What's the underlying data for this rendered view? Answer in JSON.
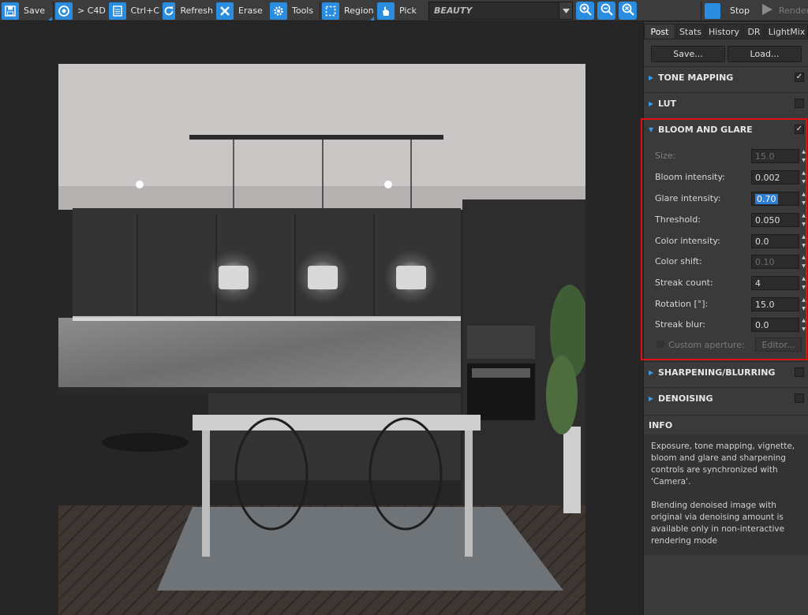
{
  "toolbar": {
    "save": "Save",
    "to_c4d": "> C4D",
    "copy": "Ctrl+C",
    "refresh": "Refresh",
    "erase": "Erase",
    "tools": "Tools",
    "region": "Region",
    "pick": "Pick",
    "render_pass": "BEAUTY",
    "stop": "Stop",
    "render": "Render"
  },
  "icons": {
    "save": "floppy-disk-icon",
    "to_c4d": "c4d-logo-icon",
    "copy": "clipboard-icon",
    "refresh": "refresh-icon",
    "erase": "erase-x-icon",
    "tools": "gear-icon",
    "region": "region-select-icon",
    "pick": "hand-pick-icon",
    "zoom_in": "zoom-in-icon",
    "zoom_out": "zoom-out-icon",
    "zoom_fit": "zoom-fit-icon",
    "stop": "stop-square-icon",
    "render": "play-icon"
  },
  "colors": {
    "accent": "#2a8de0",
    "highlight_border": "#e01010",
    "panel_bg": "#3a3a3a",
    "viewport_bg": "#262626"
  },
  "panel": {
    "tabs": [
      "Post",
      "Stats",
      "History",
      "DR",
      "LightMix"
    ],
    "active_tab": "Post",
    "save_button": "Save...",
    "load_button": "Load...",
    "sections": {
      "tone_mapping": {
        "label": "TONE MAPPING",
        "enabled": true,
        "expanded": false
      },
      "lut": {
        "label": "LUT",
        "enabled": false,
        "expanded": false
      },
      "bloom": {
        "label": "BLOOM AND GLARE",
        "enabled": true,
        "expanded": true
      },
      "sharpening": {
        "label": "SHARPENING/BLURRING",
        "enabled": false,
        "expanded": false
      },
      "denoising": {
        "label": "DENOISING",
        "enabled": false,
        "expanded": false
      }
    },
    "bloom_params": [
      {
        "label": "Size:",
        "value": "15.0",
        "disabled": true
      },
      {
        "label": "Bloom intensity:",
        "value": "0.002",
        "disabled": false
      },
      {
        "label": "Glare intensity:",
        "value": "0.70",
        "disabled": false,
        "selected": true
      },
      {
        "label": "Threshold:",
        "value": "0.050",
        "disabled": false
      },
      {
        "label": "Color intensity:",
        "value": "0.0",
        "disabled": false
      },
      {
        "label": "Color shift:",
        "value": "0.10",
        "disabled": true
      },
      {
        "label": "Streak count:",
        "value": "4",
        "disabled": false
      },
      {
        "label": "Rotation [°]:",
        "value": "15.0",
        "disabled": false
      },
      {
        "label": "Streak blur:",
        "value": "0.0",
        "disabled": false
      }
    ],
    "custom_aperture": {
      "label": "Custom aperture:",
      "checked": false,
      "editor_button": "Editor..."
    },
    "info": {
      "heading": "INFO",
      "paragraphs": [
        "Exposure, tone mapping, vignette, bloom and glare and sharpening controls are synchronized with 'Camera'.",
        "Blending denoised image with original via denoising amount is available only in non-interactive rendering mode"
      ]
    }
  }
}
